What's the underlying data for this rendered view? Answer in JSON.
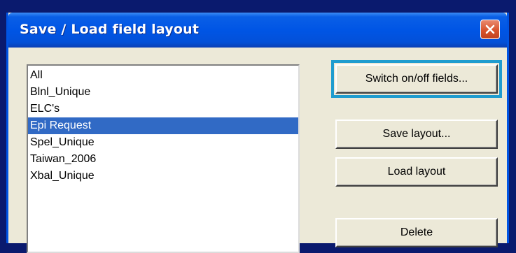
{
  "window": {
    "title": "Save / Load field layout"
  },
  "layouts": {
    "items": [
      "All",
      "Blnl_Unique",
      "ELC's",
      "Epi Request",
      "Spel_Unique",
      "Taiwan_2006",
      "Xbal_Unique"
    ],
    "selected": "Epi Request"
  },
  "buttons": {
    "switch_fields": "Switch on/off fields...",
    "save_layout": "Save layout...",
    "load_layout": "Load layout",
    "delete": "Delete"
  },
  "colors": {
    "selection": "#316ac5",
    "focus_highlight": "#1f9ccf",
    "titlebar": "#0055e5",
    "close_button": "#d8532d"
  },
  "icons": {
    "close": "close-icon"
  }
}
